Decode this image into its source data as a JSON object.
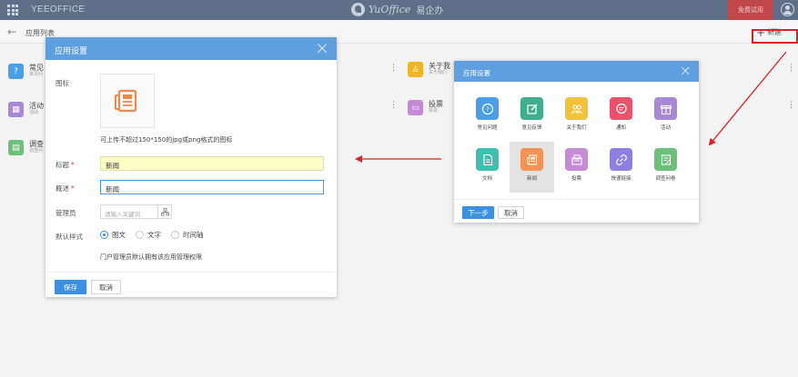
{
  "topbar": {
    "brand": "YEEOFFICE",
    "logo_text": "YuOffice",
    "logo_cn": "易企办",
    "trial_label": "免费试用"
  },
  "subheader": {
    "title": "应用列表",
    "new_label": "新建"
  },
  "background_list": [
    {
      "title": "常见",
      "sub": "常见问",
      "color": "#4aa0e6"
    },
    {
      "title": "活动",
      "sub": "活动",
      "color": "#a889d8"
    },
    {
      "title": "调查",
      "sub": "调查问",
      "color": "#6cc07a"
    },
    {
      "title": "关于我",
      "sub": "关于我们",
      "color": "#f0b429"
    },
    {
      "title": "投票",
      "sub": "投票",
      "color": "#c58bd4"
    }
  ],
  "left_modal": {
    "title": "应用设置",
    "icon_label": "图标",
    "upload_hint": "可上传不超过150*150的jpg或png格式的图标",
    "title_label": "标题",
    "title_value": "新闻",
    "summary_label": "概述",
    "summary_value": "新闻",
    "admin_label": "管理员",
    "admin_placeholder": "请输入关键词",
    "style_label": "默认样式",
    "style_options": [
      "图文",
      "文字",
      "时间轴"
    ],
    "style_selected": "图文",
    "admin_note": "门户管理员默认拥有该应用管理权限",
    "save_label": "保存",
    "cancel_label": "取消",
    "required_mark": "*"
  },
  "right_modal": {
    "title": "应用设置",
    "apps": [
      {
        "label": "常见问题",
        "color": "#4aa0e6",
        "icon": "question-icon"
      },
      {
        "label": "意见反馈",
        "color": "#3fae8f",
        "icon": "edit-icon"
      },
      {
        "label": "关于我们",
        "color": "#f3c13a",
        "icon": "team-icon"
      },
      {
        "label": "通知",
        "color": "#e8536a",
        "icon": "chat-icon"
      },
      {
        "label": "活动",
        "color": "#a889d8",
        "icon": "gift-icon"
      },
      {
        "label": "文档",
        "color": "#3fbfae",
        "icon": "document-icon"
      },
      {
        "label": "新闻",
        "color": "#f39355",
        "icon": "newspaper-icon"
      },
      {
        "label": "投票",
        "color": "#c58bd4",
        "icon": "vote-icon"
      },
      {
        "label": "快速链接",
        "color": "#8e7fe0",
        "icon": "link-icon"
      },
      {
        "label": "调查问卷",
        "color": "#6cc07a",
        "icon": "survey-icon"
      }
    ],
    "selected": "新闻",
    "next_label": "下一步",
    "cancel_label": "取消"
  }
}
